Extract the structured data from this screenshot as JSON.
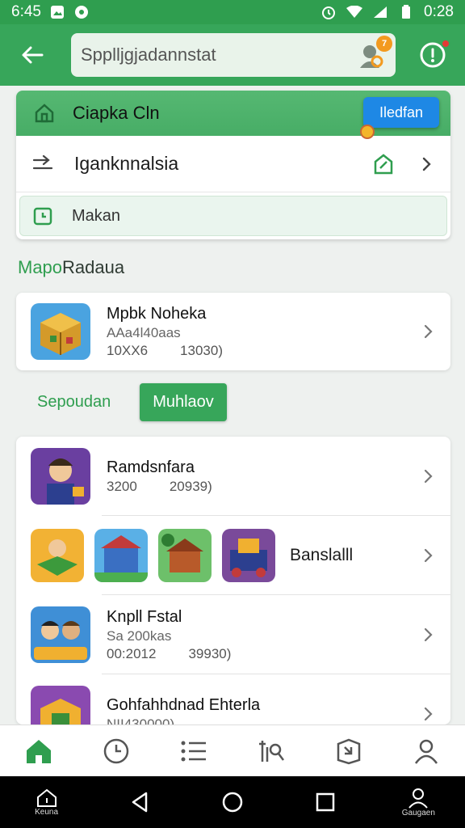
{
  "status_bar": {
    "time_left": "6:45",
    "time_right": "0:28"
  },
  "search": {
    "value": "Spplljgjadannstat",
    "badge": "7"
  },
  "top_card": {
    "header_title": "Ciapka Cln",
    "header_button": "Iledfan",
    "link_row": "Iganknnalsia",
    "date_row": "Makan"
  },
  "section": {
    "title_accent": "Mapo",
    "title_rest": "Radaua"
  },
  "featured_game": {
    "title": "Mpbk Noheka",
    "subtitle": "AAa4l40aas",
    "meta_left": "10XX6",
    "meta_right": "13030)"
  },
  "tabs": {
    "plain": "Sepoudan",
    "active": "Muhlaov"
  },
  "list": [
    {
      "title": "Ramdsnfara",
      "meta_left": "3200",
      "meta_right": "20939)"
    },
    {
      "title": "Banslalll"
    },
    {
      "title": "Knpll Fstal",
      "subtitle": "Sa 200kas",
      "meta_left": "00:2012",
      "meta_right": "39930)"
    },
    {
      "title": "Gohfahhdnad Ehterla",
      "subtitle": "NII430000)"
    }
  ],
  "system_nav": {
    "left_label": "Keuna",
    "right_label": "Gaugaen"
  },
  "colors": {
    "primary": "#37a65a",
    "accent_blue": "#1e88e5",
    "badge_orange": "#f39a1f"
  }
}
